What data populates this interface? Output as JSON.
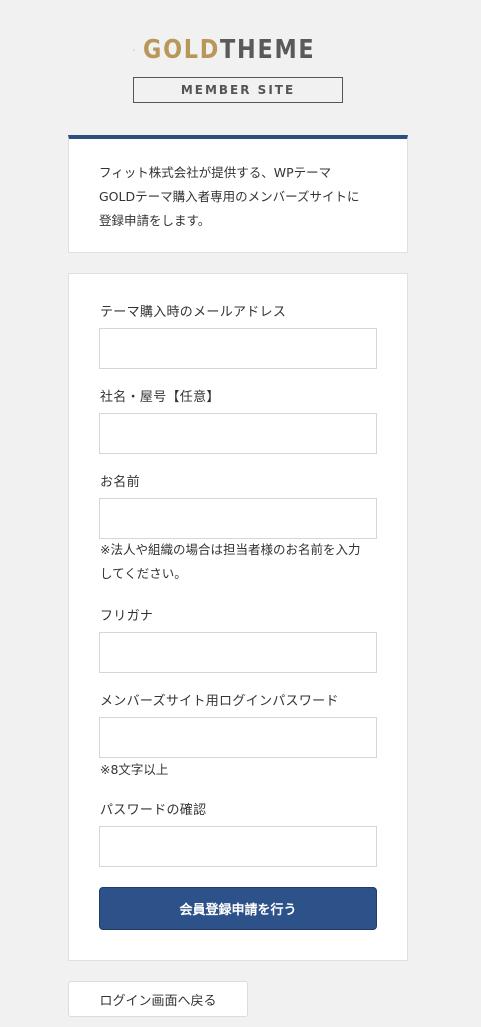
{
  "brand": {
    "logo_gold": "GOLD",
    "logo_theme": "THEME",
    "subtitle": "MEMBER SITE",
    "gold_color": "#b9975b"
  },
  "intro": {
    "lines": [
      "フィット株式会社が提供する、WPテーマ",
      "GOLDテーマ購入者専用のメンバーズサイトに",
      "登録申請をします。"
    ]
  },
  "form": {
    "fields": [
      {
        "label": "テーマ購入時のメールアドレス",
        "value": ""
      },
      {
        "label": "社名・屋号【任意】",
        "value": ""
      },
      {
        "label": "お名前",
        "value": ""
      },
      {
        "label": "フリガナ",
        "value": ""
      },
      {
        "label": "メンバーズサイト用ログインパスワード",
        "value": ""
      },
      {
        "label": "パスワードの確認",
        "value": ""
      }
    ],
    "name_note": [
      "※法人や組織の場合は担当者様のお名前を入力",
      "してください。"
    ],
    "password_note": "※8文字以上",
    "submit_label": "会員登録申請を行う",
    "accent_color": "#2d5289"
  },
  "back_link": "ログイン画面へ戻る"
}
